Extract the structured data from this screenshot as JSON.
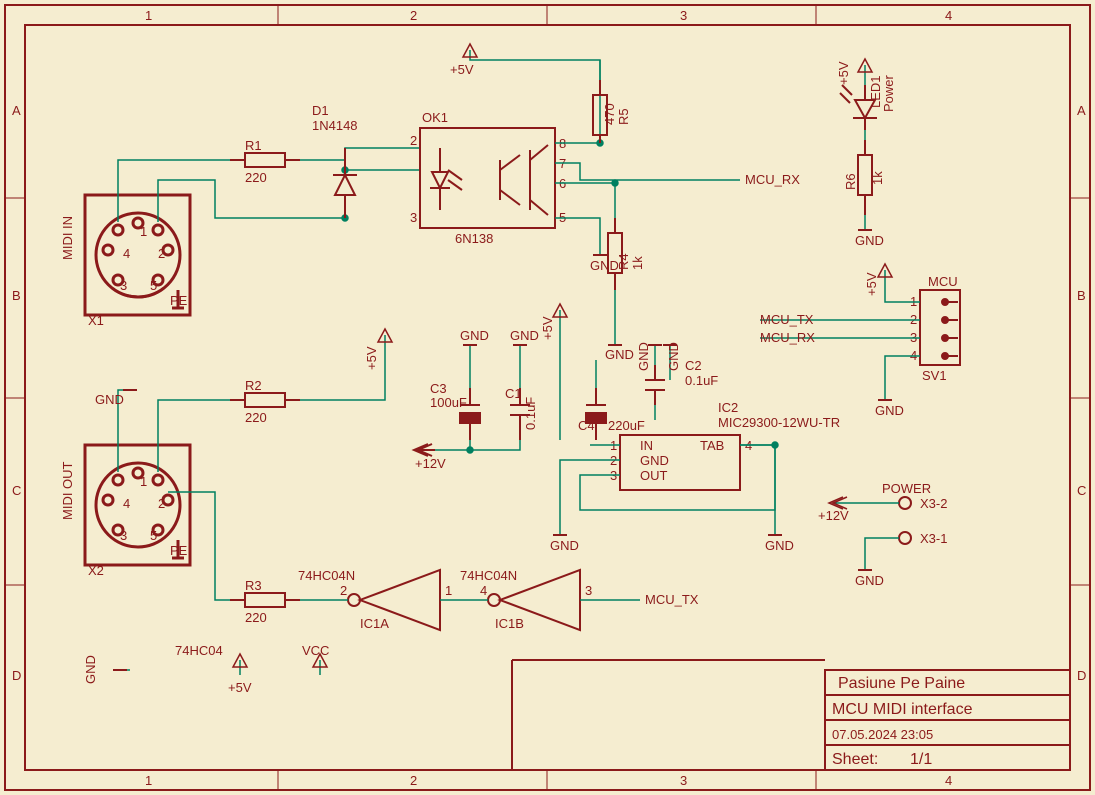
{
  "frame": {
    "cols": [
      "1",
      "2",
      "3",
      "4"
    ],
    "rows": [
      "A",
      "B",
      "C",
      "D"
    ]
  },
  "title": {
    "org": "Pasiune Pe Paine",
    "name": "MCU MIDI interface",
    "date": "07.05.2024 23:05",
    "sheet_lbl": "Sheet:",
    "sheet_val": "1/1"
  },
  "conn": {
    "midi_in": {
      "ref": "X1",
      "label": "MIDI IN",
      "pins": [
        "1",
        "2",
        "3",
        "4",
        "5"
      ],
      "pe": "PE"
    },
    "midi_out": {
      "ref": "X2",
      "label": "MIDI OUT",
      "pins": [
        "1",
        "2",
        "3",
        "4",
        "5"
      ],
      "pe": "PE"
    },
    "mcu_hdr": {
      "ref": "SV1",
      "label": "MCU",
      "pins": [
        "1",
        "2",
        "3",
        "4"
      ]
    },
    "power": {
      "label": "POWER",
      "p1": "X3-1",
      "p2": "X3-2"
    }
  },
  "parts": {
    "R1": {
      "ref": "R1",
      "val": "220"
    },
    "R2": {
      "ref": "R2",
      "val": "220"
    },
    "R3": {
      "ref": "R3",
      "val": "220"
    },
    "R4": {
      "ref": "R4",
      "val": "1k"
    },
    "R5": {
      "ref": "R5",
      "val": "470"
    },
    "R6": {
      "ref": "R6",
      "val": "1k"
    },
    "D1": {
      "ref": "D1",
      "val": "1N4148"
    },
    "LED1": {
      "ref": "LED1",
      "val": "Power"
    },
    "OK1": {
      "ref": "OK1",
      "val": "6N138",
      "pins": [
        "2",
        "3",
        "5",
        "6",
        "7",
        "8"
      ]
    },
    "IC1A": {
      "ref": "IC1A",
      "type": "74HC04N",
      "pins": [
        "1",
        "2"
      ]
    },
    "IC1B": {
      "ref": "IC1B",
      "type": "74HC04N",
      "pins": [
        "3",
        "4"
      ]
    },
    "IC1_pwr": {
      "ref": "74HC04",
      "vcc": "VCC"
    },
    "IC2": {
      "ref": "IC2",
      "val": "MIC29300-12WU-TR",
      "pins": {
        "in": "IN",
        "gnd": "GND",
        "out": "OUT",
        "tab": "TAB",
        "n1": "1",
        "n2": "2",
        "n3": "3",
        "n4": "4"
      }
    },
    "C1": {
      "ref": "C1",
      "val": "0.1uF"
    },
    "C2": {
      "ref": "C2",
      "val": "0.1uF"
    },
    "C3": {
      "ref": "C3",
      "val": "100uF"
    },
    "C4": {
      "ref": "C4",
      "val": "220uF"
    }
  },
  "nets": {
    "v5": "+5V",
    "v12": "+12V",
    "gnd": "GND",
    "mcu_rx": "MCU_RX",
    "mcu_tx": "MCU_TX"
  }
}
